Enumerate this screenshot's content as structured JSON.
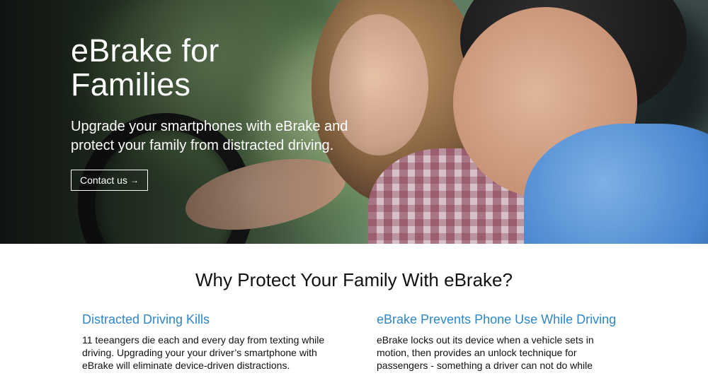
{
  "hero": {
    "title_line1": "eBrake for",
    "title_line2": "Families",
    "subtitle": "Upgrade your smartphones with eBrake and protect your family from distracted driving.",
    "button_label": "Contact us",
    "button_arrow": "→"
  },
  "section": {
    "title": "Why Protect Your Family With eBrake?",
    "columns": [
      {
        "title": "Distracted Driving Kills",
        "text": "11 teeangers die each and every day from texting while driving. Upgrading your your driver’s smartphone with eBrake will eliminate device-driven distractions."
      },
      {
        "title": "eBrake Prevents Phone Use While Driving",
        "text": "eBrake locks out its device when a vehicle sets in motion, then provides an unlock technique for passengers - something a driver can not do while"
      }
    ]
  },
  "colors": {
    "accent": "#2f86c8",
    "hero_text": "#ffffff"
  }
}
